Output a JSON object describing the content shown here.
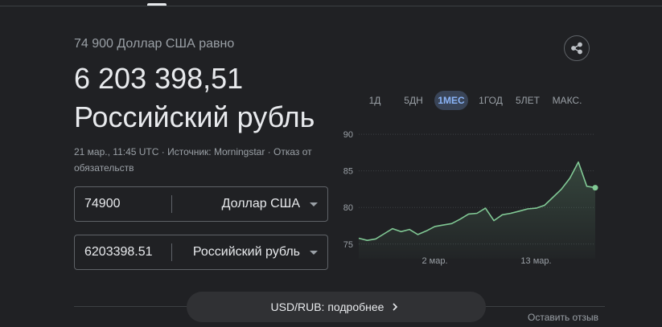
{
  "summary": {
    "prefix": "74 900 Доллар США равно",
    "amount": "6 203 398,51",
    "currency": "Российский рубль",
    "note": "21 мар., 11:45 UTC · Источник: Morningstar · Отказ от обязательств"
  },
  "converter": {
    "from": {
      "value": "74900",
      "currency": "Доллар США"
    },
    "to": {
      "value": "6203398.51",
      "currency": "Российский рубль"
    }
  },
  "share": {
    "icon": "share-icon"
  },
  "ranges": [
    "1Д",
    "5ДН",
    "1МЕС",
    "1ГОД",
    "5ЛЕТ",
    "МАКС."
  ],
  "active_range": "1МЕС",
  "chart_data": {
    "type": "area",
    "ylim": [
      73,
      91
    ],
    "yticks": [
      "90",
      "85",
      "80",
      "75"
    ],
    "xticks": [
      "2 мар.",
      "13 мар."
    ],
    "values": [
      75.8,
      75.5,
      75.7,
      76.4,
      77.1,
      76.7,
      77.0,
      76.3,
      76.8,
      77.4,
      77.6,
      77.8,
      78.4,
      79.1,
      79.2,
      79.9,
      78.2,
      79.0,
      79.2,
      79.5,
      79.8,
      79.9,
      80.3,
      81.4,
      82.5,
      84.0,
      86.2,
      82.9,
      82.7
    ],
    "line_color": "#81c995"
  },
  "more_button": {
    "label": "USD/RUB: подробнее"
  },
  "feedback": "Оставить отзыв"
}
